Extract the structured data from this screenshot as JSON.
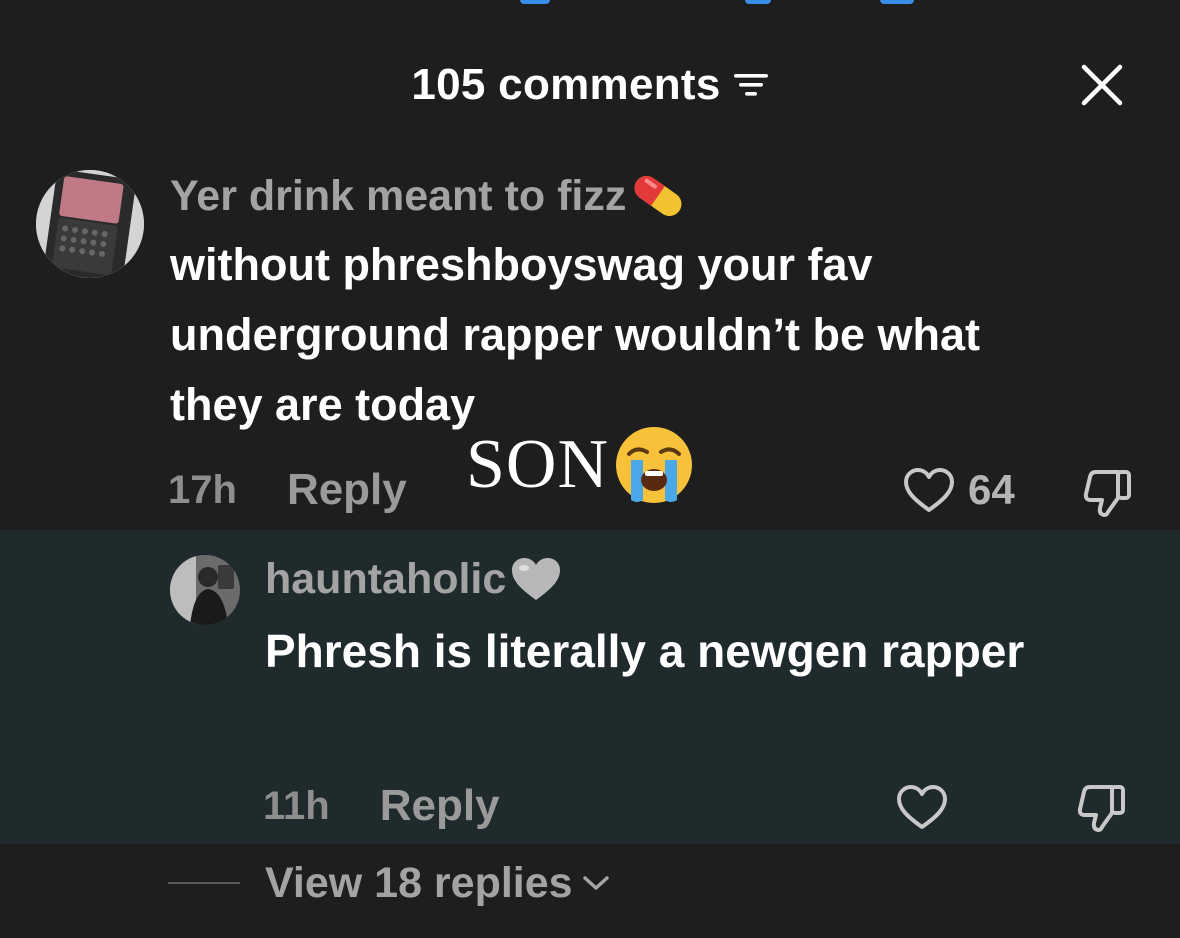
{
  "header": {
    "title": "105 comments",
    "filter_icon": "filter-icon",
    "close_icon": "close-icon"
  },
  "comment": {
    "username": "Yer drink meant to fizz",
    "username_emoji": "pill-emoji",
    "body": "without phreshboyswag your fav underground rapper wouldn’t be what they are today",
    "time": "17h",
    "reply_label": "Reply",
    "likes": "64",
    "sticker_text": "SON",
    "sticker_emoji": "loudly-crying-face-emoji"
  },
  "reply": {
    "username": "hauntaholic",
    "username_emoji": "grey-heart-emoji",
    "body": "Phresh is literally a newgen rapper",
    "time": "11h",
    "reply_label": "Reply"
  },
  "view_replies": {
    "label": "View 18 replies"
  },
  "colors": {
    "background": "#1e1e1e",
    "reply_highlight": "#1f2a2c",
    "text_primary": "#ffffff",
    "text_secondary": "#a3a3a3"
  }
}
